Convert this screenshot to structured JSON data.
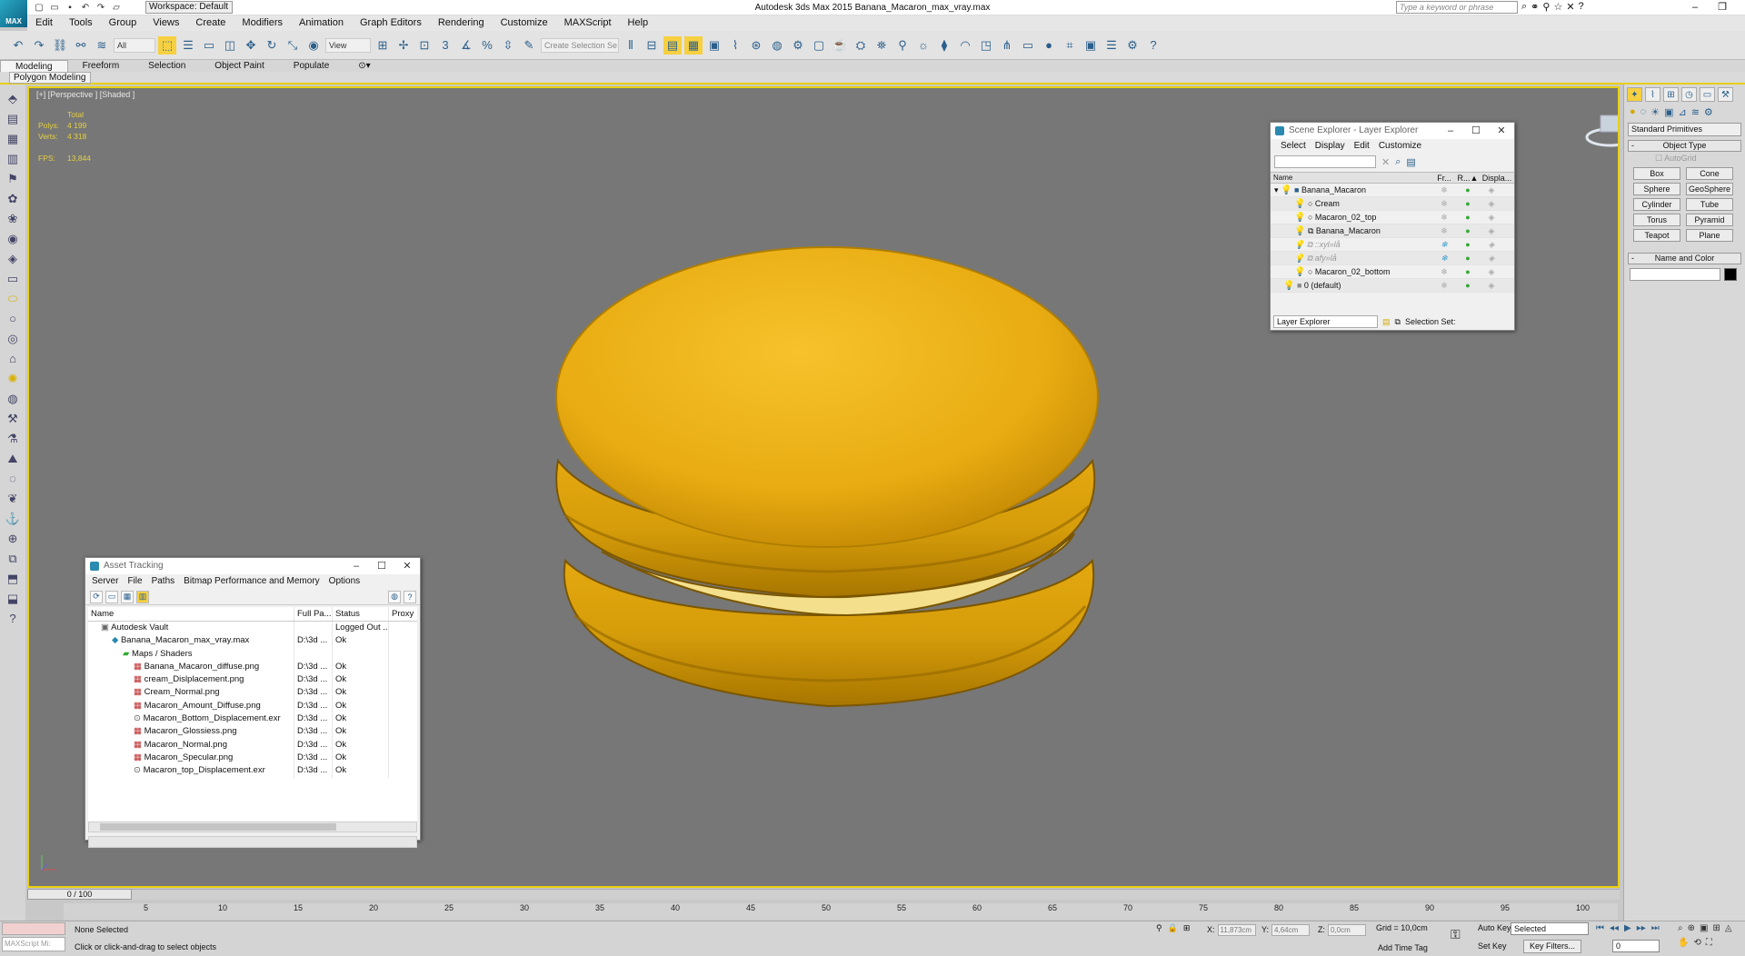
{
  "app": {
    "logo_text": "MAX",
    "title": "Autodesk 3ds Max  2015     Banana_Macaron_max_vray.max",
    "workspace": "Workspace: Default",
    "search_placeholder": "Type a keyword or phrase"
  },
  "menu": [
    "Edit",
    "Tools",
    "Group",
    "Views",
    "Create",
    "Modifiers",
    "Animation",
    "Graph Editors",
    "Rendering",
    "Customize",
    "MAXScript",
    "Help"
  ],
  "toolbar": {
    "filter": "All",
    "refcoord": "View",
    "selection_set": "Create Selection Se"
  },
  "ribbon": {
    "tabs": [
      "Modeling",
      "Freeform",
      "Selection",
      "Object Paint",
      "Populate"
    ],
    "active": "Modeling",
    "panel": "Polygon Modeling"
  },
  "viewport": {
    "label": "[+] [Perspective ] [Shaded ]",
    "stats_header": "Total",
    "polys_label": "Polys:",
    "polys": "4 199",
    "verts_label": "Verts:",
    "verts": "4 318",
    "fps_label": "FPS:",
    "fps": "13,844"
  },
  "scene_explorer": {
    "title": "Scene Explorer - Layer Explorer",
    "menu": [
      "Select",
      "Display",
      "Edit",
      "Customize"
    ],
    "columns": [
      "Name",
      "Fr...",
      "R...▲",
      "Displa..."
    ],
    "rows": [
      {
        "name": "Banana_Macaron",
        "indent": 0
      },
      {
        "name": "Cream",
        "indent": 2
      },
      {
        "name": "Macaron_02_top",
        "indent": 2
      },
      {
        "name": "Banana_Macaron",
        "indent": 2
      },
      {
        "name": "::xyl»lå",
        "indent": 2
      },
      {
        "name": "afy»lå",
        "indent": 2
      },
      {
        "name": "Macaron_02_bottom",
        "indent": 2
      },
      {
        "name": "0 (default)",
        "indent": 0
      }
    ],
    "layer_dropdown": "Layer Explorer",
    "selection_set": "Selection Set:"
  },
  "asset_tracking": {
    "title": "Asset Tracking",
    "menu": [
      "Server",
      "File",
      "Paths",
      "Bitmap Performance and Memory",
      "Options"
    ],
    "columns": [
      "Name",
      "Full Pa...",
      "Status",
      "Proxy"
    ],
    "rows": [
      {
        "name": "Autodesk Vault",
        "path": "",
        "status": "Logged Out ...",
        "indent": 1
      },
      {
        "name": "Banana_Macaron_max_vray.max",
        "path": "D:\\3d ...",
        "status": "Ok",
        "indent": 2
      },
      {
        "name": "Maps / Shaders",
        "path": "",
        "status": "",
        "indent": 3
      },
      {
        "name": "Banana_Macaron_diffuse.png",
        "path": "D:\\3d ...",
        "status": "Ok",
        "indent": 4
      },
      {
        "name": "cream_Dislplacement.png",
        "path": "D:\\3d ...",
        "status": "Ok",
        "indent": 4
      },
      {
        "name": "Cream_Normal.png",
        "path": "D:\\3d ...",
        "status": "Ok",
        "indent": 4
      },
      {
        "name": "Macaron_Amount_Diffuse.png",
        "path": "D:\\3d ...",
        "status": "Ok",
        "indent": 4
      },
      {
        "name": "Macaron_Bottom_Displacement.exr",
        "path": "D:\\3d ...",
        "status": "Ok",
        "indent": 4
      },
      {
        "name": "Macaron_Glossiess.png",
        "path": "D:\\3d ...",
        "status": "Ok",
        "indent": 4
      },
      {
        "name": "Macaron_Normal.png",
        "path": "D:\\3d ...",
        "status": "Ok",
        "indent": 4
      },
      {
        "name": "Macaron_Specular.png",
        "path": "D:\\3d ...",
        "status": "Ok",
        "indent": 4
      },
      {
        "name": "Macaron_top_Displacement.exr",
        "path": "D:\\3d ...",
        "status": "Ok",
        "indent": 4
      }
    ]
  },
  "command_panel": {
    "category": "Standard Primitives",
    "object_type": "Object Type",
    "autogrid": "AutoGrid",
    "primitives": [
      "Box",
      "Cone",
      "Sphere",
      "GeoSphere",
      "Cylinder",
      "Tube",
      "Torus",
      "Pyramid",
      "Teapot",
      "Plane"
    ],
    "name_and_color": "Name and Color",
    "object_color": "#000000"
  },
  "timeline": {
    "slider": "0 / 100",
    "ticks": [
      "5",
      "10",
      "15",
      "20",
      "25",
      "30",
      "35",
      "40",
      "45",
      "50",
      "55",
      "60",
      "65",
      "70",
      "75",
      "80",
      "85",
      "90",
      "95",
      "100"
    ]
  },
  "status": {
    "maxscript": "MAXScript Mi:",
    "selection": "None Selected",
    "hint": "Click or click-and-drag to select objects",
    "x_label": "X:",
    "x": "11,873cm",
    "y_label": "Y:",
    "y": "4,64cm",
    "z_label": "Z:",
    "z": "0,0cm",
    "grid": "Grid = 10,0cm",
    "add_time_tag": "Add Time Tag",
    "auto_key": "Auto Key",
    "set_key": "Set Key",
    "selected": "Selected",
    "key_filters": "Key Filters...",
    "frame": "0"
  },
  "colors": {
    "viewport_border": "#e8d010",
    "stats": "#e4d040",
    "macaron": "#f0b820"
  }
}
